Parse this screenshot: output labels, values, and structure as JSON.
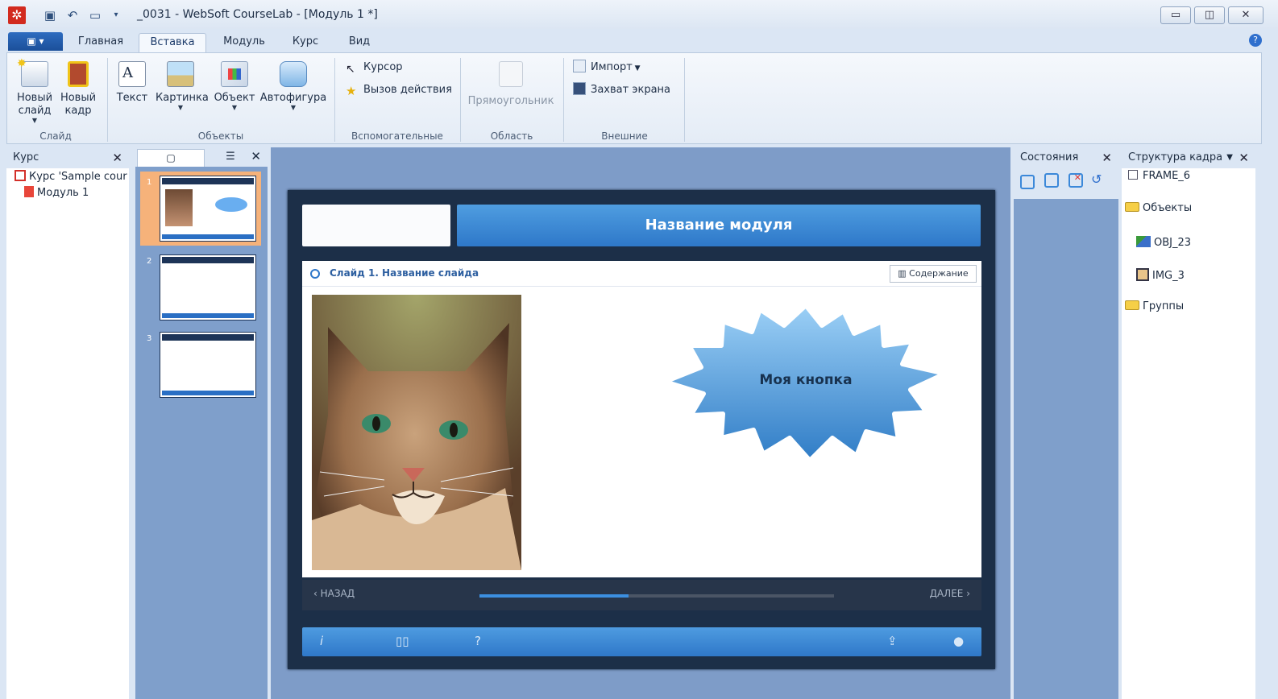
{
  "window": {
    "title": "_0031 - WebSoft CourseLab - [Модуль 1 *]",
    "controls": {
      "minimize": "▭",
      "restore": "◫",
      "close": "✕"
    }
  },
  "quick_access": [
    "save-icon",
    "undo-icon",
    "monitor-icon",
    "customize-icon"
  ],
  "tabs": [
    "Главная",
    "Вставка",
    "Модуль",
    "Курс",
    "Вид"
  ],
  "ribbon": {
    "slide_group": {
      "label": "Слайд",
      "new_slide": "Новый слайд",
      "new_frame": "Новый кадр"
    },
    "objects_group": {
      "label": "Объекты",
      "text": "Текст",
      "picture": "Картинка",
      "object": "Объект",
      "autoshape": "Автофигура"
    },
    "aux_group": {
      "label": "Вспомогательные",
      "cursor": "Курсор",
      "action": "Вызов действия"
    },
    "area_group": {
      "label": "Область",
      "rect": "Прямоугольник"
    },
    "external_group": {
      "label": "Внешние",
      "import": "Импорт",
      "capture": "Захват экрана"
    }
  },
  "course_panel": {
    "title": "Курс",
    "items": [
      "Курс 'Sample cour",
      "Модуль 1"
    ]
  },
  "thumb_panel": {
    "numbers": [
      "1",
      "2",
      "3"
    ]
  },
  "slide": {
    "module_title": "Название модуля",
    "slide_title": "Слайд 1. Название слайда",
    "contents_btn": "Содержание",
    "button_text": "Моя кнопка",
    "nav_prev": "НАЗАД",
    "nav_next": "ДАЛЕЕ",
    "progress": 0.42
  },
  "states_panel": {
    "title": "Состояния"
  },
  "structure_panel": {
    "title": "Структура кадра",
    "items": [
      "FRAME_6",
      "Объекты",
      "OBJ_23",
      "IMG_3",
      "Группы"
    ]
  },
  "colors": {
    "accent": "#2e78c9",
    "slide_bg": "#1c2f48",
    "stage_bg": "#7e9cc8"
  }
}
